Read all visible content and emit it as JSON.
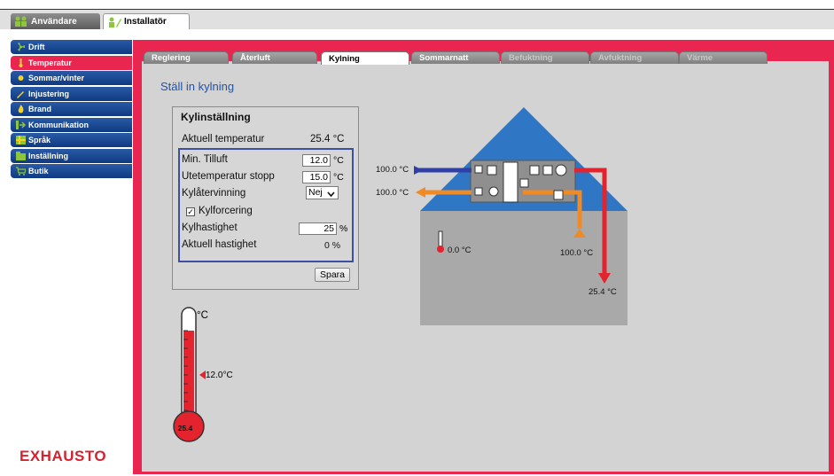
{
  "topbar": {
    "tabs": [
      {
        "label": "Användare",
        "icon": "users-icon"
      },
      {
        "label": "Installatör",
        "icon": "installer-icon"
      }
    ]
  },
  "sidebar": {
    "items": [
      {
        "label": "Drift",
        "icon": "fan-icon"
      },
      {
        "label": "Temperatur",
        "icon": "thermometer-icon"
      },
      {
        "label": "Sommar/vinter",
        "icon": "sun-icon"
      },
      {
        "label": "Injustering",
        "icon": "wrench-icon"
      },
      {
        "label": "Brand",
        "icon": "fire-icon"
      },
      {
        "label": "Kommunikation",
        "icon": "network-icon"
      },
      {
        "label": "Språk",
        "icon": "flag-icon"
      },
      {
        "label": "Inställning",
        "icon": "folder-icon"
      },
      {
        "label": "Butik",
        "icon": "cart-icon"
      }
    ]
  },
  "brand": "EXHAUSTO",
  "tabs": [
    {
      "label": "Reglering"
    },
    {
      "label": "Återluft"
    },
    {
      "label": "Kylning"
    },
    {
      "label": "Sommarnatt"
    },
    {
      "label": "Befuktning"
    },
    {
      "label": "Avfuktning"
    },
    {
      "label": "Värme"
    }
  ],
  "page_title": "Ställ in kylning",
  "panel": {
    "title": "Kylinställning",
    "current_temp_label": "Aktuell temperatur",
    "current_temp_value": "25.4 °C",
    "min_supply_label": "Min. Tilluft",
    "min_supply_value": "12.0",
    "min_supply_unit": "°C",
    "outdoor_stop_label": "Utetemperatur stopp",
    "outdoor_stop_value": "15.0",
    "outdoor_stop_unit": "°C",
    "recovery_label": "Kylåtervinning",
    "recovery_value": "Nej",
    "forcing_label": "Kylforcering",
    "forcing_checked": true,
    "speed_label": "Kylhastighet",
    "speed_value": "25",
    "speed_unit": "%",
    "actual_speed_label": "Aktuell hastighet",
    "actual_speed_value": "0 %",
    "save_label": "Spara"
  },
  "thermometer": {
    "unit": "°C",
    "marker_label": "12.0°C",
    "bulb_value": "25.4"
  },
  "diagram": {
    "outdoor_in": "100.0 °C",
    "exhaust_out": "100.0 °C",
    "room_temp": "0.0 °C",
    "extract_temp": "100.0 °C",
    "supply_temp": "25.4 °C"
  },
  "colors": {
    "accent_red": "#e8264f",
    "nav_blue": "#0e3a82",
    "roof_blue": "#2f76c4",
    "cold_blue": "#2f3fa5",
    "warm_orange": "#f08a24",
    "supply_red": "#e3232d"
  }
}
